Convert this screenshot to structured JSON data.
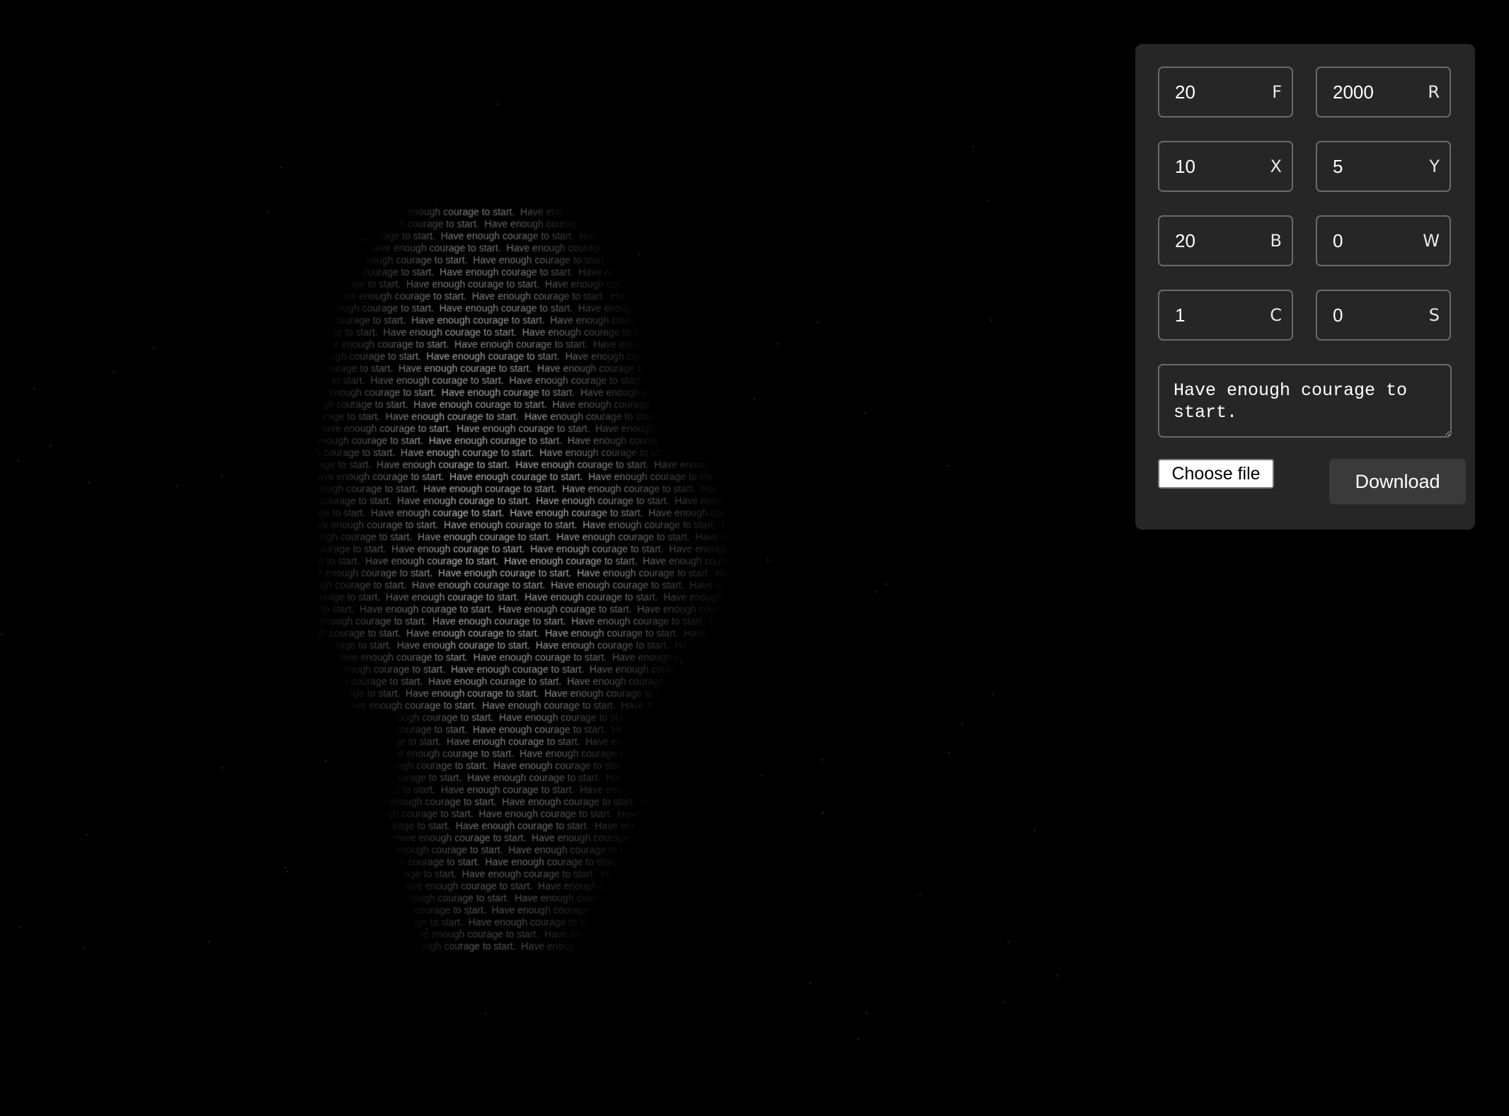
{
  "artwork": {
    "repeated_text": "Have enough courage to start.",
    "background_color": "#000000",
    "text_color": "#ffffff"
  },
  "controls": {
    "fields": [
      {
        "value": "20",
        "suffix": "F"
      },
      {
        "value": "2000",
        "suffix": "R"
      },
      {
        "value": "10",
        "suffix": "X"
      },
      {
        "value": "5",
        "suffix": "Y"
      },
      {
        "value": "20",
        "suffix": "B"
      },
      {
        "value": "0",
        "suffix": "W"
      },
      {
        "value": "1",
        "suffix": "C"
      },
      {
        "value": "0",
        "suffix": "S"
      }
    ],
    "text_value": "Have enough courage to start.",
    "choose_file_label": "Choose file",
    "file_status": "",
    "download_label": "Download"
  },
  "colors": {
    "panel_background": "#262626",
    "field_border": "#6a6a6a",
    "download_background": "#3a3a3a"
  }
}
